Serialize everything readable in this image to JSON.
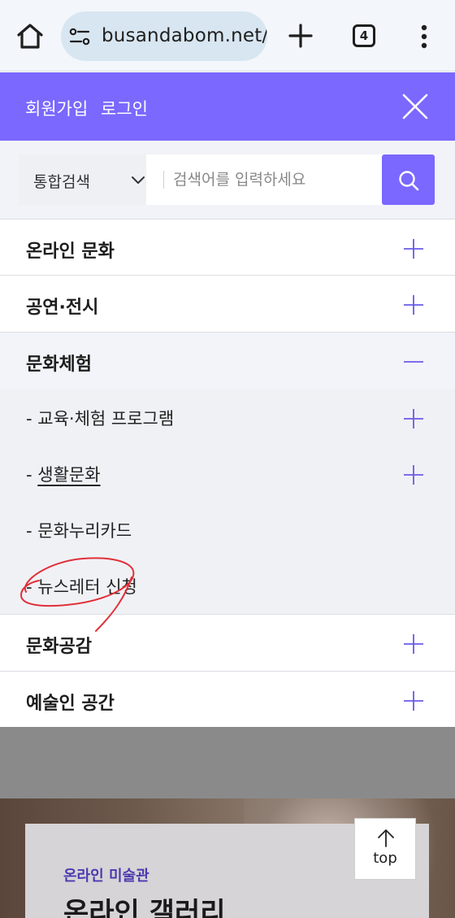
{
  "browser": {
    "url": "busandabom.net/",
    "tab_count": "4"
  },
  "header": {
    "signup_label": "회원가입",
    "login_label": "로그인"
  },
  "search": {
    "scope_label": "통합검색",
    "placeholder": "검색어를 입력하세요"
  },
  "menu": {
    "items": [
      {
        "label": "온라인 문화"
      },
      {
        "label": "공연·전시"
      },
      {
        "label": "문화체험"
      },
      {
        "label": "문화공감"
      },
      {
        "label": "예술인 공간"
      }
    ],
    "submenu": [
      {
        "label": "교육·체험 프로그램"
      },
      {
        "label": "생활문화"
      },
      {
        "label": "문화누리카드"
      },
      {
        "label": "뉴스레터 신청"
      }
    ]
  },
  "hero": {
    "category": "온라인 미술관",
    "title": "온라인 갤러리"
  },
  "top_button": {
    "label": "top"
  },
  "colors": {
    "accent": "#7a68ff",
    "annotation": "#e0303a"
  }
}
